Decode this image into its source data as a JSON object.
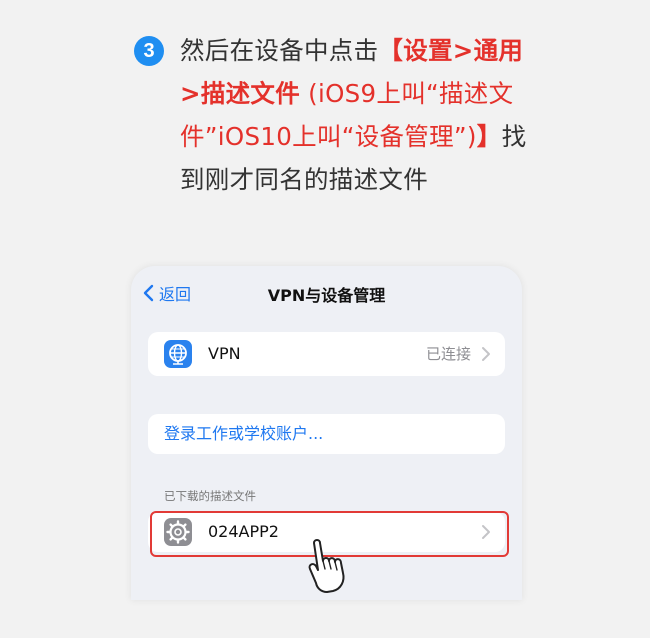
{
  "instruction": {
    "step": "3",
    "part1": "然后在设备中点击",
    "part2": "【设置>通用>描述文件",
    "part3": " (iOS9上叫“描述文件”iOS10上叫“设备管理”)",
    "part4": "】",
    "part5": "找到刚才同名的描述文件"
  },
  "nav": {
    "back_label": "返回",
    "title": "VPN与设备管理"
  },
  "vpn_row": {
    "label": "VPN",
    "status": "已连接"
  },
  "login_row": {
    "label": "登录工作或学校账户..."
  },
  "profiles_section": {
    "header": "已下载的描述文件",
    "item_label": "024APP2"
  },
  "colors": {
    "accent_blue": "#1f78f0",
    "highlight_red": "#e23a36",
    "text_red": "#e4312b"
  }
}
